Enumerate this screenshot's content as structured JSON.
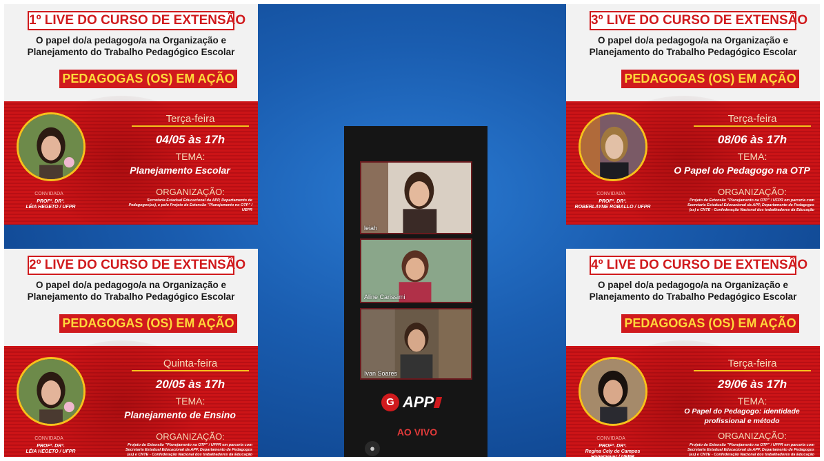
{
  "posters": [
    {
      "title": "1º LIVE DO CURSO DE EXTENSÃO",
      "subtitle_1": "O papel do/a pedagogo/a na Organização e",
      "subtitle_2": "Planejamento do Trabalho Pedagógico Escolar",
      "band": "PEDAGOGAS (OS) EM AÇÃO",
      "day": "Terça-feira",
      "date": "04/05 às 17h",
      "tema_label": "TEMA:",
      "tema": "Planejamento Escolar",
      "org_label": "ORGANIZAÇÃO:",
      "org_text": "Secretaria Estadual Educacional da APP, Departamento de Pedagogos(as), e pelo Projeto de Extensão \"Planejamento no OTP\" / UEPR",
      "convidada": "CONVIDADA",
      "prof": "PROFª. DRª.\nLÉIA HEGETO / UFPR"
    },
    {
      "title": "3º LIVE DO CURSO DE EXTENSÃO",
      "subtitle_1": "O papel do/a pedagogo/a na Organização e",
      "subtitle_2": "Planejamento do Trabalho Pedagógico Escolar",
      "band": "PEDAGOGAS (OS) EM AÇÃO",
      "day": "Terça-feira",
      "date": "08/06 às 17h",
      "tema_label": "TEMA:",
      "tema": "O Papel do Pedagogo na OTP",
      "org_label": "ORGANIZAÇÃO:",
      "org_text": "Projeto de Extensão \"Planejamento na OTP\" / UFPR em parceria com Secretaria Estadual Educacional da APP, Departamento de Pedagogos (as) e CNTE - Confederação Nacional dos trabalhadores da Educação",
      "convidada": "CONVIDADA",
      "prof": "PROFª. DRª.\nROBERLAYNE ROBALLO / UFPR"
    },
    {
      "title": "2º LIVE DO CURSO DE EXTENSÃO",
      "subtitle_1": "O papel do/a pedagogo/a na Organização e",
      "subtitle_2": "Planejamento do Trabalho Pedagógico Escolar",
      "band": "PEDAGOGAS (OS) EM AÇÃO",
      "day": "Quinta-feira",
      "date": "20/05 às 17h",
      "tema_label": "TEMA:",
      "tema": "Planejamento de Ensino",
      "org_label": "ORGANIZAÇÃO:",
      "org_text": "Projeto de Extensão \"Planejamento na OTP\" / UFPR em parceria com Secretaria Estadual Educacional da APP, Departamento de Pedagogos (as) e CNTE - Confederação Nacional dos trabalhadores da Educação",
      "convidada": "CONVIDADA",
      "prof": "PROFª. DRª.\nLÉIA HEGETO / UFPR"
    },
    {
      "title": "4º LIVE DO CURSO DE EXTENSÃO",
      "subtitle_1": "O papel do/a pedagogo/a na Organização e",
      "subtitle_2": "Planejamento do Trabalho Pedagógico Escolar",
      "band": "PEDAGOGAS (OS) EM AÇÃO",
      "day": "Terça-feira",
      "date": "29/06 às 17h",
      "tema_label": "TEMA:",
      "tema": "O Papel do Pedagogo: identidade profissional e método",
      "org_label": "ORGANIZAÇÃO:",
      "org_text": "Projeto de Extensão \"Planejamento na OTP\" / UFPR em parceria com Secretaria Estadual Educacional da APP, Departamento de Pedagogos (as) e CNTE - Confederação Nacional dos trabalhadores da Educação",
      "convidada": "CONVIDADA",
      "prof": "PROFª. DRª.\nRegina Cely de Campos\nHagemeyer / UFPR"
    }
  ],
  "phone": {
    "participants": [
      "leiah",
      "Aline Carissimi",
      "Ivan Soares"
    ],
    "app_name": "APP",
    "app_icon": "app-sindicato-logo-icon",
    "live_label": "AO VIVO",
    "user_icon": "user-icon"
  },
  "colors": {
    "accent_red": "#d01a1d",
    "band_yellow": "#ffd83a",
    "ring_yellow": "#f6c21c",
    "background_blue": "#1a5db0"
  }
}
